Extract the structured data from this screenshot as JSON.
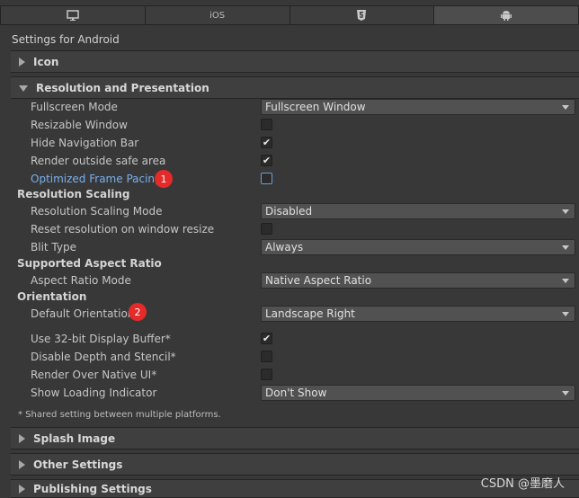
{
  "tabs": [
    {
      "label": "",
      "icon": "monitor-icon"
    },
    {
      "label": "iOS",
      "icon": ""
    },
    {
      "label": "",
      "icon": "html5-icon"
    },
    {
      "label": "",
      "icon": "android-icon"
    }
  ],
  "header": {
    "title": "Settings for Android"
  },
  "sections": {
    "icon": "Icon",
    "resolution": "Resolution and Presentation",
    "splash": "Splash Image",
    "other": "Other Settings",
    "publishing": "Publishing Settings"
  },
  "resolution": {
    "fullscreen_mode_label": "Fullscreen Mode",
    "fullscreen_mode_value": "Fullscreen Window",
    "resizable_window_label": "Resizable Window",
    "resizable_window_checked": false,
    "hide_nav_bar_label": "Hide Navigation Bar",
    "hide_nav_bar_checked": true,
    "render_outside_safe_label": "Render outside safe area",
    "render_outside_safe_checked": true,
    "optimized_frame_pacing_label": "Optimized Frame Pacing",
    "optimized_frame_pacing_checked": false,
    "scaling_heading": "Resolution Scaling",
    "scaling_mode_label": "Resolution Scaling Mode",
    "scaling_mode_value": "Disabled",
    "reset_resolution_label": "Reset resolution on window resize",
    "reset_resolution_checked": false,
    "blit_type_label": "Blit Type",
    "blit_type_value": "Always",
    "aspect_heading": "Supported Aspect Ratio",
    "aspect_mode_label": "Aspect Ratio Mode",
    "aspect_mode_value": "Native Aspect Ratio",
    "orientation_heading": "Orientation",
    "default_orientation_label": "Default Orientation*",
    "default_orientation_value": "Landscape Right",
    "use32bit_label": "Use 32-bit Display Buffer*",
    "use32bit_checked": true,
    "disable_depth_label": "Disable Depth and Stencil*",
    "disable_depth_checked": false,
    "render_over_native_label": "Render Over Native UI*",
    "render_over_native_checked": false,
    "loading_indicator_label": "Show Loading Indicator",
    "loading_indicator_value": "Don't Show",
    "footnote": "* Shared setting between multiple platforms."
  },
  "badges": {
    "first": "1",
    "second": "2"
  },
  "watermark": "CSDN @墨磨人",
  "colors": {
    "background": "#383838",
    "highlight_text": "#7ab0ec",
    "badge": "#e52a2a"
  }
}
